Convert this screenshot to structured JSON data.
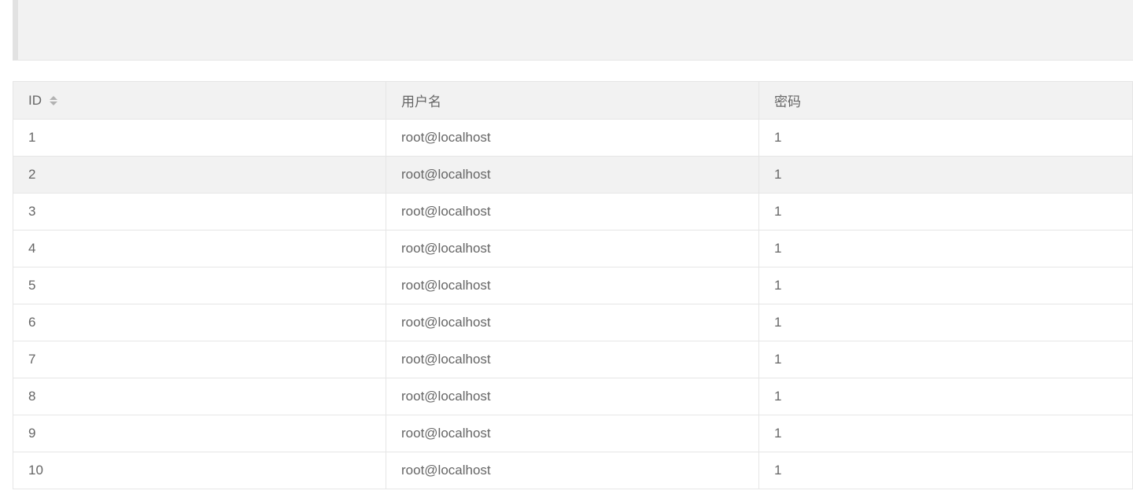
{
  "table": {
    "headers": [
      "ID",
      "用户名",
      "密码"
    ],
    "sort_icon": "sort-icon",
    "rows": [
      [
        "1",
        "root@localhost",
        "1"
      ],
      [
        "2",
        "root@localhost",
        "1"
      ],
      [
        "3",
        "root@localhost",
        "1"
      ],
      [
        "4",
        "root@localhost",
        "1"
      ],
      [
        "5",
        "root@localhost",
        "1"
      ],
      [
        "6",
        "root@localhost",
        "1"
      ],
      [
        "7",
        "root@localhost",
        "1"
      ],
      [
        "8",
        "root@localhost",
        "1"
      ],
      [
        "9",
        "root@localhost",
        "1"
      ],
      [
        "10",
        "root@localhost",
        "1"
      ]
    ],
    "highlighted_row": 2
  },
  "colors": {
    "header_bg": "#f2f2f2",
    "border": "#e6e6e6",
    "text": "#666666",
    "quote_bg": "#f2f2f2",
    "quote_border": "#e2e2e2"
  }
}
